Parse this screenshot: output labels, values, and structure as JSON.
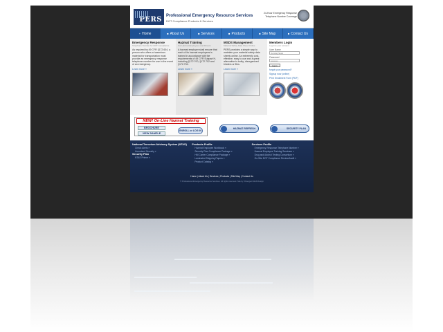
{
  "header": {
    "logo_text": "PERS",
    "title": "Professional Emergency Resource Services",
    "subtitle": "DOT Compliance Products & Services",
    "hotline_line1": "24-Hour Emergency Response",
    "hotline_line2": "Telephone Number Coverage"
  },
  "nav": [
    {
      "label": "Home",
      "icon": "home-icon"
    },
    {
      "label": "About Us",
      "icon": "info-icon"
    },
    {
      "label": "Services",
      "icon": "services-icon"
    },
    {
      "label": "Products",
      "icon": "products-icon"
    },
    {
      "label": "Site Map",
      "icon": "sitemap-icon"
    },
    {
      "label": "Contact Us",
      "icon": "contact-icon"
    }
  ],
  "columns": {
    "emergency": {
      "title": "Emergency Response",
      "sub": "Telephone Number for DOT Compliance",
      "body": "As required by 49 CFR §172.604, a person who offers a hazardous material for transportation must provide an emergency response telephone number for use in the event of an emergency.",
      "more": "Learn more »"
    },
    "hazmat": {
      "title": "Hazmat Training",
      "sub": "For Hazmat Employees and Drivers",
      "body": "A hazmat employer shall ensure that each of its hazmat employees is trained in accordance with the requirements of 49 CFR Subpart H, including §172.700, §172.702 and §172.704.",
      "more": "Learn more »"
    },
    "msds": {
      "title": "MSDS Management",
      "sub": "Material Safety Data Sheet Online",
      "body": "PERS provides a simple way to maintain your material safety data sheets online. An extremely cost-effective, easy to use and a great alternative to bulky, disorganized binders or files.",
      "more": "Learn more »"
    },
    "login": {
      "title": "Members Login",
      "sub": "Log into your account",
      "user_label": "User Name",
      "user_value": "Coming Soon",
      "pass_label": "Password",
      "pass_value": "••••••••••",
      "button": "log in",
      "forgot": "forgot your password?",
      "signup": "Signup now (online)",
      "print_form": "Print Enrollment Form (PDF)"
    }
  },
  "promo": {
    "title": "NEW! On-Line Hazmat Training",
    "brochure": "BROCHURE",
    "sample": "VIEW SAMPLE",
    "enroll": "ENROLL or LOG IN",
    "hazmat_refresh": "HAZMAT REFRESH",
    "security_plan": "SECURITY PLAN"
  },
  "footer": {
    "col1": {
      "title": "National Terrorism Advisory System (NTAS)",
      "links": [
        "Check Alerts »",
        "Homeland Security »"
      ],
      "title2": "Security Plan",
      "links2": [
        "NTAS Primer »"
      ]
    },
    "col2": {
      "title": "Products Profile",
      "links": [
        "Hazmat Employee Workbook »",
        "Security Plan Compliance Package »",
        "HM Carrier Compliance Package »",
        "Laminated Shipping Papers »",
        "Product Catalog »"
      ]
    },
    "col3": {
      "title": "Services Profile",
      "links": [
        "Emergency Response Telephone Number »",
        "Hazmat Employee Training Seminars »",
        "Drug and Alcohol Testing Consortium »",
        "On-Site DOT Compliance Review/Audit »"
      ]
    },
    "nav": "Home | About Us | Services | Products | Site Map | Contact Us",
    "copyright": "© Professional Emergency Resource Services. All rights reserved. Site by: Divergent Web Design"
  }
}
